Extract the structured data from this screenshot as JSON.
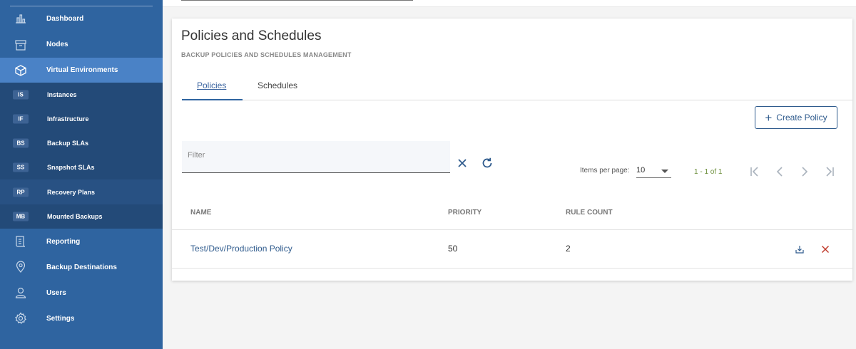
{
  "sidebar": {
    "items": [
      {
        "label": "Dashboard",
        "icon": "bar-chart-icon"
      },
      {
        "label": "Nodes",
        "icon": "archive-box-icon"
      },
      {
        "label": "Virtual Environments",
        "icon": "cube-icon"
      },
      {
        "label": "Reporting",
        "icon": "report-icon"
      },
      {
        "label": "Backup Destinations",
        "icon": "location-pin-icon"
      },
      {
        "label": "Users",
        "icon": "user-icon"
      },
      {
        "label": "Settings",
        "icon": "gear-icon"
      }
    ],
    "sub_items": [
      {
        "abbr": "IS",
        "label": "Instances"
      },
      {
        "abbr": "IF",
        "label": "Infrastructure"
      },
      {
        "abbr": "BS",
        "label": "Backup SLAs"
      },
      {
        "abbr": "SS",
        "label": "Snapshot SLAs"
      },
      {
        "abbr": "RP",
        "label": "Recovery Plans"
      },
      {
        "abbr": "MB",
        "label": "Mounted Backups"
      }
    ]
  },
  "card": {
    "title": "Policies and Schedules",
    "subtitle": "BACKUP POLICIES AND SCHEDULES MANAGEMENT"
  },
  "tabs": [
    {
      "label": "Policies"
    },
    {
      "label": "Schedules"
    }
  ],
  "toolbar": {
    "create_label": "Create Policy",
    "filter_placeholder": "Filter"
  },
  "pagination": {
    "items_per_page_label": "Items per page:",
    "items_per_page_value": "10",
    "range": "1 - 1 of 1"
  },
  "table": {
    "columns": [
      "NAME",
      "PRIORITY",
      "RULE COUNT"
    ],
    "rows": [
      {
        "name": "Test/Dev/Production Policy",
        "priority": "50",
        "rule_count": "2"
      }
    ]
  },
  "colors": {
    "sidebar": "#2f64a0",
    "sidebar_active": "#4a82c6",
    "sidebar_sub": "#234a78",
    "accent": "#2f5b8d",
    "delete": "#c0392b",
    "range_text": "#6b8e3a"
  }
}
